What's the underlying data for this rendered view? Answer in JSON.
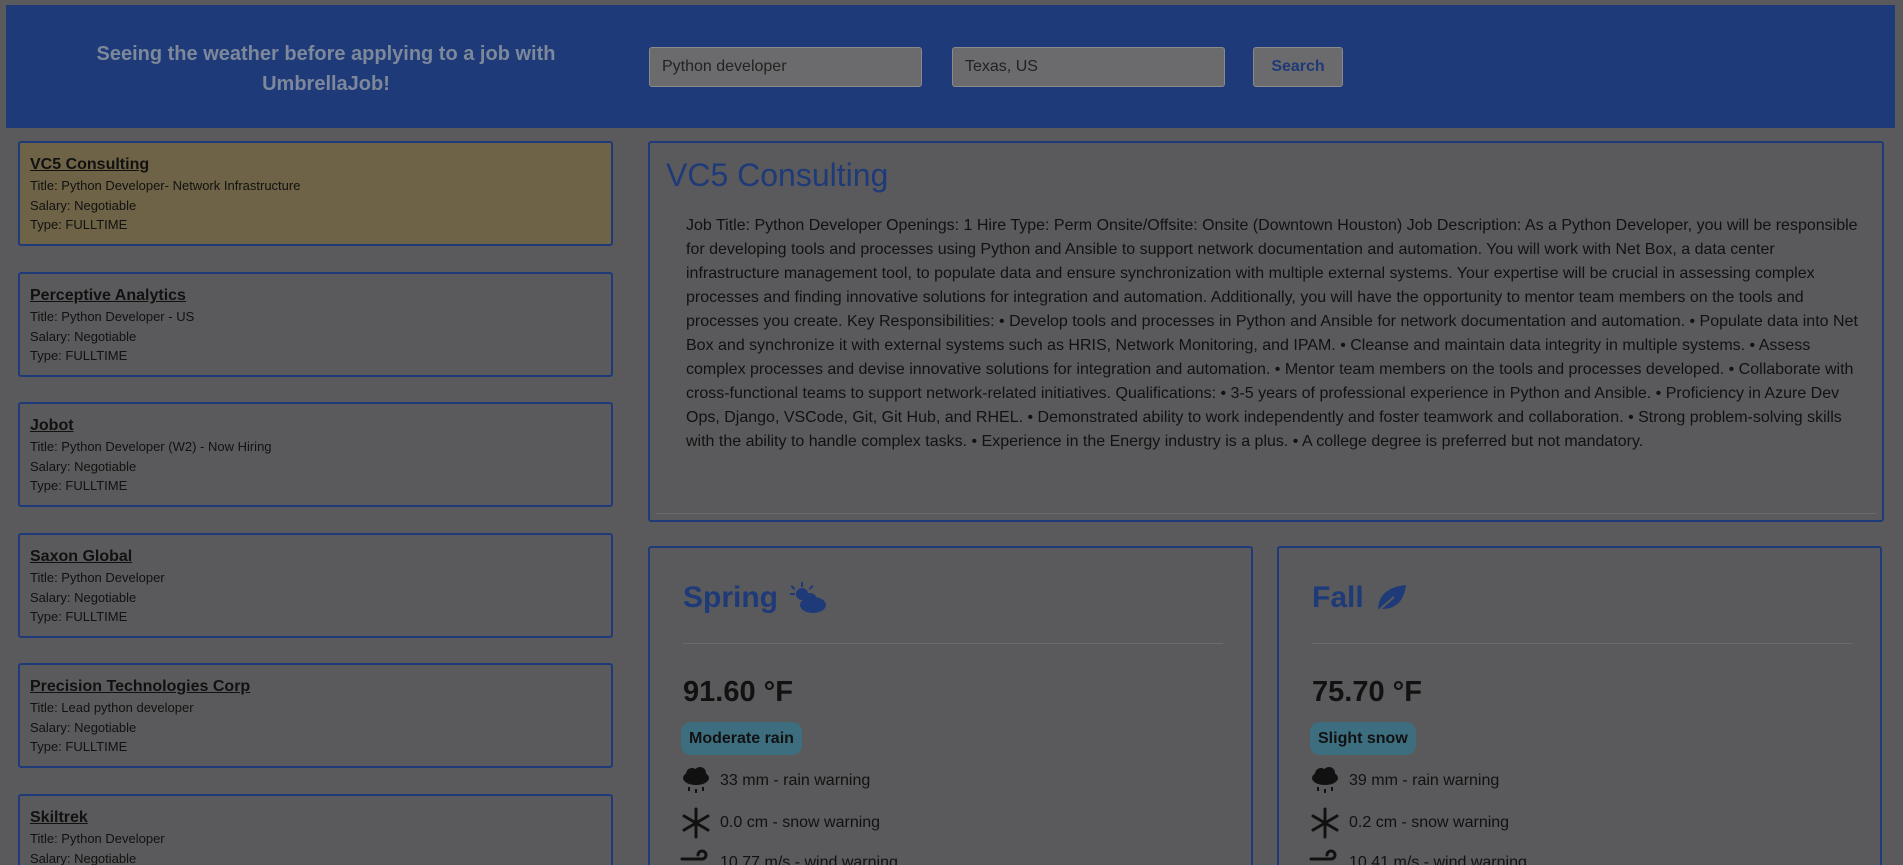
{
  "header": {
    "tagline": "Seeing the weather before applying to a job with UmbrellaJob!",
    "query_value": "Python developer",
    "location_value": "Texas, US",
    "search_label": "Search"
  },
  "jobs": [
    {
      "company": "VC5 Consulting",
      "title": "Title: Python Developer- Network Infrastructure",
      "salary": "Salary: Negotiable",
      "type": "Type: FULLTIME"
    },
    {
      "company": "Perceptive Analytics",
      "title": "Title: Python Developer - US",
      "salary": "Salary: Negotiable",
      "type": "Type: FULLTIME"
    },
    {
      "company": "Jobot",
      "title": "Title: Python Developer (W2) - Now Hiring",
      "salary": "Salary: Negotiable",
      "type": "Type: FULLTIME"
    },
    {
      "company": "Saxon Global",
      "title": "Title: Python Developer",
      "salary": "Salary: Negotiable",
      "type": "Type: FULLTIME"
    },
    {
      "company": "Precision Technologies Corp",
      "title": "Title: Lead python developer",
      "salary": "Salary: Negotiable",
      "type": "Type: FULLTIME"
    },
    {
      "company": "Skiltrek",
      "title": "Title: Python Developer",
      "salary": "Salary: Negotiable",
      "type": ""
    }
  ],
  "detail": {
    "company": "VC5 Consulting",
    "description": "Job Title: Python Developer Openings: 1 Hire Type: Perm Onsite/Offsite: Onsite (Downtown Houston) Job Description: As a Python Developer, you will be responsible for developing tools and processes using Python and Ansible to support network documentation and automation. You will work with Net Box, a data center infrastructure management tool, to populate data and ensure synchronization with multiple external systems. Your expertise will be crucial in assessing complex processes and finding innovative solutions for integration and automation. Additionally, you will have the opportunity to mentor team members on the tools and processes you create. Key Responsibilities: • Develop tools and processes in Python and Ansible for network documentation and automation. • Populate data into Net Box and synchronize it with external systems such as HRIS, Network Monitoring, and IPAM. • Cleanse and maintain data integrity in multiple systems. • Assess complex processes and devise innovative solutions for integration and automation. • Mentor team members on the tools and processes developed. • Collaborate with cross-functional teams to support network-related initiatives. Qualifications: • 3-5 years of professional experience in Python and Ansible. • Proficiency in Azure Dev Ops, Django, VSCode, Git, Git Hub, and RHEL. • Demonstrated ability to work independently and foster teamwork and collaboration. • Strong problem-solving skills with the ability to handle complex tasks. • Experience in the Energy industry is a plus. • A college degree is preferred but not mandatory."
  },
  "weather": {
    "spring": {
      "season": "Spring",
      "icon": "sun-cloud-icon",
      "temp": "91.60 °F",
      "condition": "Moderate rain",
      "rain": "33 mm - rain warning",
      "snow": "0.0 cm - snow warning",
      "wind": "10.77 m/s - wind warning"
    },
    "fall": {
      "season": "Fall",
      "icon": "leaf-icon",
      "temp": "75.70 °F",
      "condition": "Slight snow",
      "rain": "39 mm - rain warning",
      "snow": "0.2 cm - snow warning",
      "wind": "10.41 m/s - wind warning"
    }
  },
  "colors": {
    "brand": "#1e3a78",
    "overlay_bg": "#5a5a5c",
    "selected_card": "#6e6346",
    "badge": "#3d6e80"
  }
}
